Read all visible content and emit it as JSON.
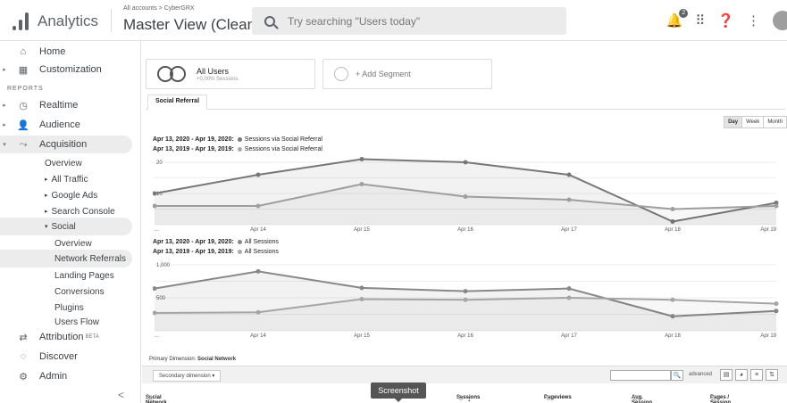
{
  "header": {
    "app_name": "Analytics",
    "breadcrumb": "All accounts > CyberGRX",
    "view_name": "Master View (Clean Traffic)",
    "search_placeholder": "Try searching \"Users today\"",
    "notification_count": "2",
    "icons": [
      "bell-icon",
      "apps-grid-icon",
      "help-icon",
      "more-vert-icon",
      "avatar"
    ]
  },
  "sidebar": {
    "home": "Home",
    "customization": "Customization",
    "reports_label": "REPORTS",
    "realtime": "Realtime",
    "audience": "Audience",
    "acquisition": "Acquisition",
    "acquisition_sub": [
      "Overview",
      "All Traffic",
      "Google Ads",
      "Search Console",
      "Social"
    ],
    "social_sub": [
      "Overview",
      "Network Referrals",
      "Landing Pages",
      "Conversions",
      "Plugins",
      "Users Flow"
    ],
    "attribution": "Attribution",
    "attribution_badge": "BETA",
    "discover": "Discover",
    "admin": "Admin",
    "collapse": "<"
  },
  "segments": {
    "all_users": "All Users",
    "all_users_sub": "+0.00% Sessions",
    "add_segment": "+ Add Segment"
  },
  "tab": "Social Referral",
  "period": [
    "Day",
    "Week",
    "Month"
  ],
  "period_selected": "Day",
  "chart1_legend": {
    "range1": "Apr 13, 2020 - Apr 19, 2020:",
    "metric1": "Sessions via Social Referral",
    "range2": "Apr 13, 2019 - Apr 19, 2019:",
    "metric2": "Sessions via Social Referral"
  },
  "chart2_legend": {
    "range1": "Apr 13, 2020 - Apr 19, 2020:",
    "metric1": "All Sessions",
    "range2": "Apr 13, 2019 - Apr 19, 2019:",
    "metric2": "All Sessions"
  },
  "chart_data": [
    {
      "type": "line",
      "x": [
        "...",
        "Apr 14",
        "Apr 15",
        "Apr 16",
        "Apr 17",
        "Apr 18",
        "Apr 19"
      ],
      "ytick_labels": [
        "20",
        "10"
      ],
      "ylim": [
        0,
        20
      ],
      "series": [
        {
          "name": "Apr 13, 2020 - Apr 19, 2020: Sessions via Social Referral",
          "values": [
            10,
            16,
            21,
            20,
            16,
            1,
            7
          ],
          "color": "#777777"
        },
        {
          "name": "Apr 13, 2019 - Apr 19, 2019: Sessions via Social Referral",
          "values": [
            6,
            6,
            13,
            9,
            8,
            5,
            6
          ],
          "color": "#9e9e9e"
        }
      ]
    },
    {
      "type": "line",
      "x": [
        "...",
        "Apr 14",
        "Apr 15",
        "Apr 16",
        "Apr 17",
        "Apr 18",
        "Apr 19"
      ],
      "ytick_labels": [
        "1,000",
        "500"
      ],
      "ylim": [
        0,
        1000
      ],
      "series": [
        {
          "name": "Apr 13, 2020 - Apr 19, 2020: All Sessions",
          "values": [
            640,
            900,
            650,
            600,
            640,
            220,
            300
          ],
          "color": "#888888"
        },
        {
          "name": "Apr 13, 2019 - Apr 19, 2019: All Sessions",
          "values": [
            270,
            280,
            480,
            470,
            500,
            470,
            410
          ],
          "color": "#a5a5a5"
        }
      ]
    }
  ],
  "table": {
    "primary_dimension_label": "Primary Dimension:",
    "primary_dimension_value": "Social Network",
    "secondary_dimension": "Secondary dimension",
    "advanced": "advanced",
    "columns": [
      "Social Network",
      "Sessions",
      "Pageviews",
      "Avg. Session Duration",
      "Pages / Session"
    ]
  },
  "tooltip": "Screenshot"
}
